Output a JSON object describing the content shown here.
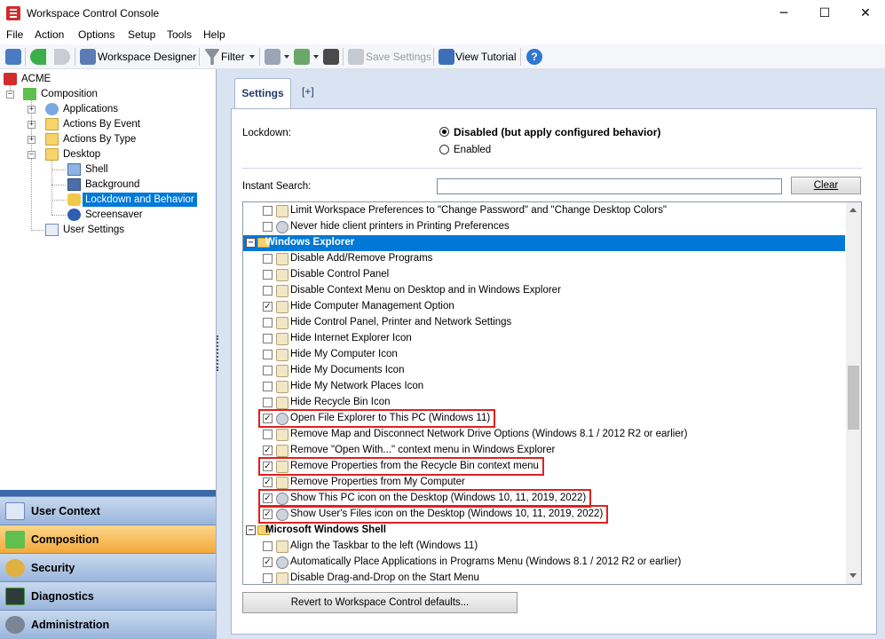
{
  "window": {
    "title": "Workspace Control Console",
    "min": "─",
    "max": "☐",
    "close": "✕"
  },
  "menu": [
    "File",
    "Action",
    "Options",
    "Setup",
    "Tools",
    "Help"
  ],
  "toolbar": {
    "workspace_designer": "Workspace Designer",
    "filter": "Filter",
    "save_settings": "Save Settings",
    "view_tutorial": "View Tutorial"
  },
  "tree": {
    "root": "ACME",
    "composition": "Composition",
    "applications": "Applications",
    "actions_by_event": "Actions By Event",
    "actions_by_type": "Actions By Type",
    "desktop": "Desktop",
    "shell": "Shell",
    "background": "Background",
    "lockdown": "Lockdown and Behavior",
    "screensaver": "Screensaver",
    "user_settings": "User Settings"
  },
  "nav": [
    "User Context",
    "Composition",
    "Security",
    "Diagnostics",
    "Administration"
  ],
  "tabs": {
    "settings": "Settings",
    "add": "[+]"
  },
  "lockdown": {
    "label": "Lockdown:",
    "option_disabled": "Disabled (but apply configured behavior)",
    "option_enabled": "Enabled"
  },
  "search": {
    "label": "Instant Search:",
    "value": "",
    "clear": "Clear"
  },
  "list_rows": [
    {
      "type": "item",
      "checked": false,
      "icon": "lock",
      "text": "Limit Workspace Preferences to \"Change Password\" and \"Change Desktop Colors\""
    },
    {
      "type": "item",
      "checked": false,
      "icon": "gear",
      "text": "Never hide client printers in Printing Preferences"
    },
    {
      "type": "group",
      "text": "Windows Explorer",
      "selected": true
    },
    {
      "type": "item",
      "checked": false,
      "icon": "lock",
      "text": "Disable Add/Remove Programs"
    },
    {
      "type": "item",
      "checked": false,
      "icon": "lock",
      "text": "Disable Control Panel"
    },
    {
      "type": "item",
      "checked": false,
      "icon": "lock",
      "text": "Disable Context Menu on Desktop and in Windows Explorer"
    },
    {
      "type": "item",
      "checked": true,
      "icon": "lock",
      "text": "Hide Computer Management Option"
    },
    {
      "type": "item",
      "checked": false,
      "icon": "lock",
      "text": "Hide Control Panel, Printer and Network Settings"
    },
    {
      "type": "item",
      "checked": false,
      "icon": "lock",
      "text": "Hide Internet Explorer Icon"
    },
    {
      "type": "item",
      "checked": false,
      "icon": "lock",
      "text": "Hide My Computer Icon"
    },
    {
      "type": "item",
      "checked": false,
      "icon": "lock",
      "text": "Hide My Documents Icon"
    },
    {
      "type": "item",
      "checked": false,
      "icon": "lock",
      "text": "Hide My Network Places Icon"
    },
    {
      "type": "item",
      "checked": false,
      "icon": "lock",
      "text": "Hide Recycle Bin Icon"
    },
    {
      "type": "item",
      "checked": true,
      "icon": "gear",
      "text": "Open File Explorer to This PC (Windows 11)",
      "highlight": true
    },
    {
      "type": "item",
      "checked": false,
      "icon": "lock",
      "text": "Remove Map and Disconnect Network Drive Options (Windows 8.1 / 2012 R2 or earlier)"
    },
    {
      "type": "item",
      "checked": true,
      "icon": "lock",
      "text": "Remove \"Open With...\" context menu in Windows Explorer"
    },
    {
      "type": "item",
      "checked": true,
      "icon": "lock",
      "text": "Remove Properties from the Recycle Bin context menu",
      "highlight": true
    },
    {
      "type": "item",
      "checked": true,
      "icon": "lock",
      "text": "Remove Properties from My Computer"
    },
    {
      "type": "item",
      "checked": true,
      "icon": "gear",
      "text": "Show This PC icon on the Desktop (Windows 10, 11, 2019, 2022)",
      "highlight": true
    },
    {
      "type": "item",
      "checked": true,
      "icon": "gear",
      "text": "Show User's Files icon on the Desktop (Windows 10, 11, 2019, 2022)",
      "highlight": true
    },
    {
      "type": "group",
      "text": "Microsoft Windows Shell",
      "selected": false
    },
    {
      "type": "item",
      "checked": false,
      "icon": "lock",
      "text": "Align the Taskbar to the left (Windows 11)"
    },
    {
      "type": "item",
      "checked": true,
      "icon": "gear",
      "text": "Automatically Place Applications in Programs Menu (Windows 8.1 / 2012 R2 or earlier)"
    },
    {
      "type": "item",
      "checked": false,
      "icon": "lock",
      "text": "Disable Drag-and-Drop on the Start Menu"
    }
  ],
  "revert_button": "Revert to Workspace Control defaults...",
  "check_mark": "✓",
  "expand_minus": "−",
  "expand_plus": "+"
}
